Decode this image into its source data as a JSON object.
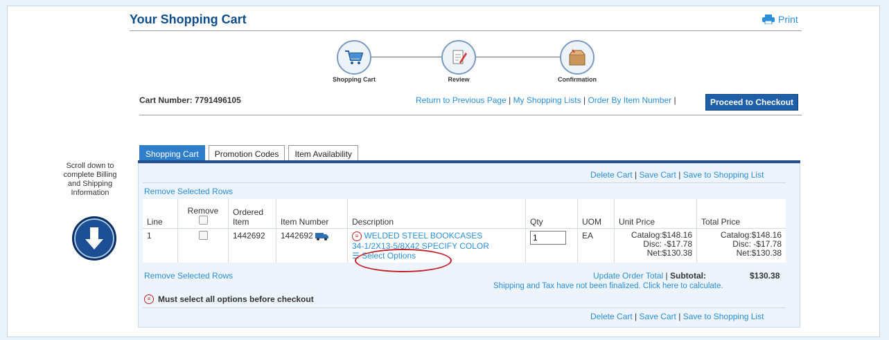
{
  "header": {
    "title": "Your Shopping Cart",
    "print_label": "Print"
  },
  "steps": [
    {
      "label": "Shopping Cart"
    },
    {
      "label": "Review"
    },
    {
      "label": "Confirmation"
    }
  ],
  "cart": {
    "number_label": "Cart Number:",
    "number": "7791496105"
  },
  "top_links": {
    "return": "Return to Previous Page",
    "my_lists": "My Shopping Lists",
    "order_by_item": "Order By Item Number",
    "sep": "|",
    "checkout": "Proceed to Checkout"
  },
  "tabs": [
    "Shopping Cart",
    "Promotion Codes",
    "Item Availability"
  ],
  "side_note": "Scroll down to complete Billing and Shipping Information",
  "panel_links": {
    "delete_cart": "Delete Cart",
    "save_cart": "Save Cart",
    "save_list": "Save to Shopping List",
    "sep": "|"
  },
  "remove_selected": "Remove Selected Rows",
  "table": {
    "headers": {
      "line": "Line",
      "remove": "Remove",
      "ordered_item": "Ordered Item",
      "item_number": "Item Number",
      "description": "Description",
      "qty": "Qty",
      "uom": "UOM",
      "unit_price": "Unit Price",
      "total_price": "Total Price"
    },
    "rows": [
      {
        "line": "1",
        "ordered_item": "1442692",
        "item_number": "1442692",
        "description_line1": "WELDED STEEL BOOKCASES",
        "description_line2": "34-1/2X13-5/8X42 SPECIFY COLOR",
        "select_options": "Select Options",
        "qty": "1",
        "uom": "EA",
        "unit_catalog": "Catalog:$148.16",
        "unit_disc": "Disc: -$17.78",
        "unit_net": "Net:$130.38",
        "total_catalog": "Catalog:$148.16",
        "total_disc": "Disc: -$17.78",
        "total_net": "Net:$130.38"
      }
    ]
  },
  "footer": {
    "update_total": "Update Order Total",
    "subtotal_label": "Subtotal:",
    "subtotal_value": "$130.38",
    "shipping_note": "Shipping and Tax have not been finalized. Click here to calculate.",
    "warning": "Must select all options before checkout"
  },
  "colors": {
    "brand": "#1e5fa8",
    "link": "#2a8fd8",
    "alert": "#c41e2a"
  }
}
